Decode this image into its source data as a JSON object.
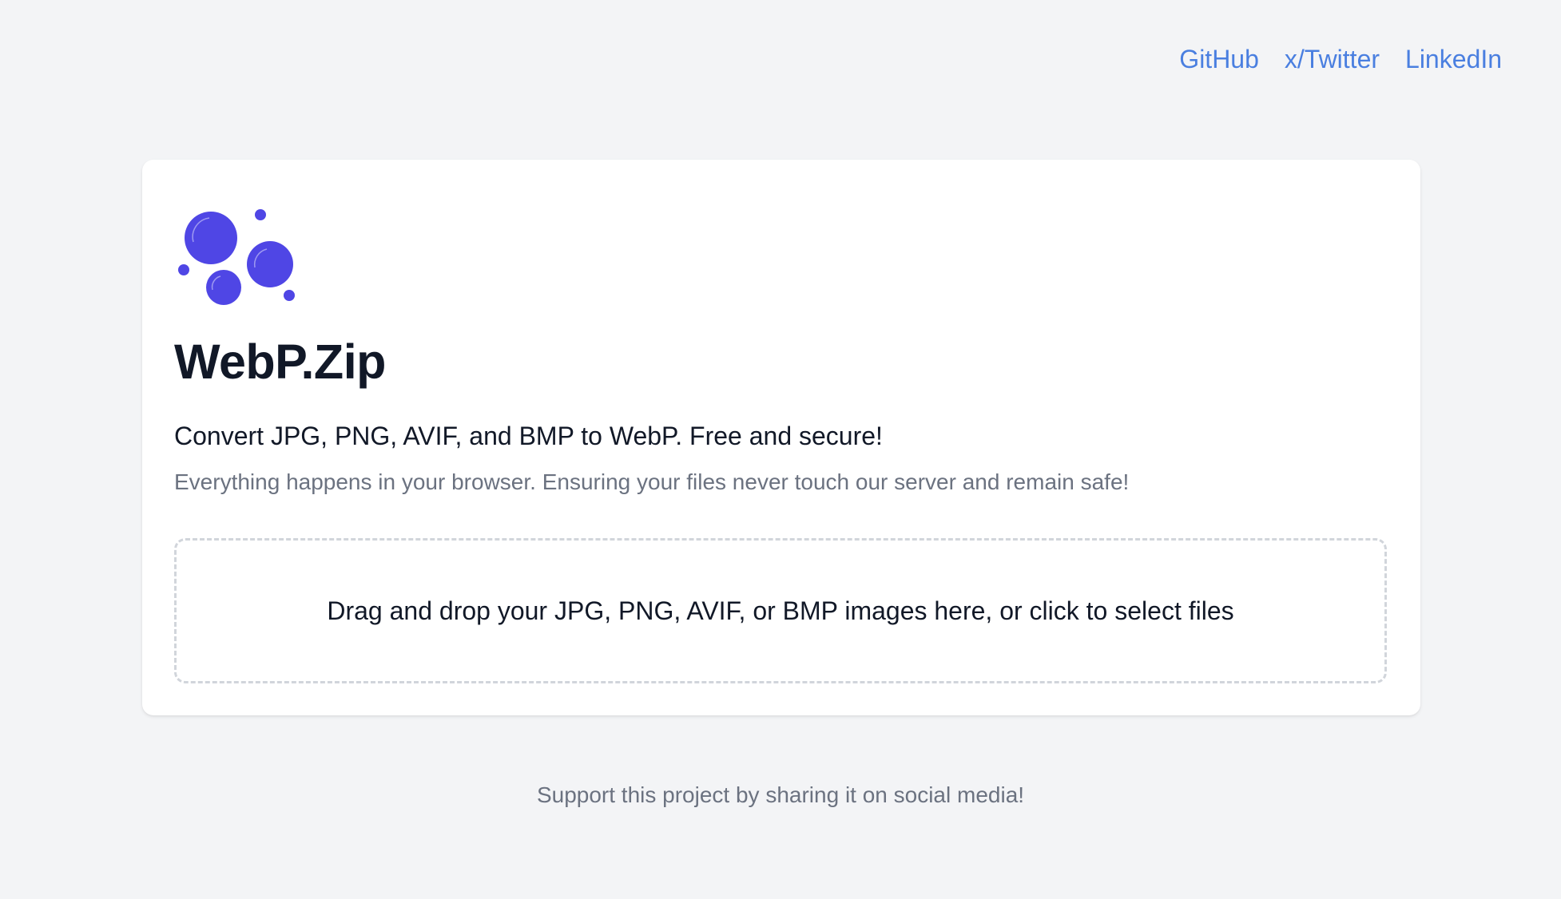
{
  "nav": {
    "links": [
      "GitHub",
      "x/Twitter",
      "LinkedIn"
    ]
  },
  "app": {
    "title": "WebP.Zip",
    "tagline": "Convert JPG, PNG, AVIF, and BMP to WebP. Free and secure!",
    "subtext": "Everything happens in your browser. Ensuring your files never touch our server and remain safe!"
  },
  "dropzone": {
    "label": "Drag and drop your JPG, PNG, AVIF, or BMP images here, or click to select files"
  },
  "footer": {
    "text": "Support this project by sharing it on social media!"
  },
  "colors": {
    "accent": "#4f46e5",
    "link": "#4a7fe0",
    "background": "#f3f4f6"
  },
  "icons": {
    "logo": "bubbles-logo-icon"
  }
}
